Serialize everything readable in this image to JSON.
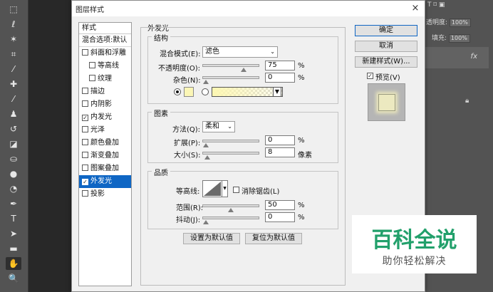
{
  "toolbar": {
    "tools": [
      {
        "icon": "marquee-icon",
        "glyph": "⬚"
      },
      {
        "icon": "lasso-icon",
        "glyph": "ℓ"
      },
      {
        "icon": "magic-wand-icon",
        "glyph": "✶"
      },
      {
        "icon": "crop-icon",
        "glyph": "⌗"
      },
      {
        "icon": "eyedropper-icon",
        "glyph": "⁄"
      },
      {
        "icon": "healing-brush-icon",
        "glyph": "✚"
      },
      {
        "icon": "brush-icon",
        "glyph": "⁄"
      },
      {
        "icon": "stamp-icon",
        "glyph": "♟"
      },
      {
        "icon": "history-brush-icon",
        "glyph": "↺"
      },
      {
        "icon": "eraser-icon",
        "glyph": "◪"
      },
      {
        "icon": "bucket-icon",
        "glyph": "⛀"
      },
      {
        "icon": "blur-icon",
        "glyph": "●"
      },
      {
        "icon": "dodge-icon",
        "glyph": "◔"
      },
      {
        "icon": "pen-icon",
        "glyph": "✒"
      },
      {
        "icon": "type-icon",
        "glyph": "T"
      },
      {
        "icon": "path-select-icon",
        "glyph": "➤"
      },
      {
        "icon": "rectangle-icon",
        "glyph": "▬"
      },
      {
        "icon": "hand-icon",
        "glyph": "✋"
      },
      {
        "icon": "zoom-icon",
        "glyph": "🔍"
      }
    ]
  },
  "right_panel": {
    "opacity_label": "透明度:",
    "opacity_value": "100%",
    "fill_label": "填充:",
    "fill_value": "100%",
    "fx": "fx"
  },
  "dialog": {
    "title": "图层样式",
    "close": "×",
    "styles_header": "样式",
    "blend_options": "混合选项:默认",
    "styles": [
      {
        "label": "斜面和浮雕",
        "checked": false,
        "indent": false,
        "selected": false
      },
      {
        "label": "等高线",
        "checked": false,
        "indent": true,
        "selected": false
      },
      {
        "label": "纹理",
        "checked": false,
        "indent": true,
        "selected": false
      },
      {
        "label": "描边",
        "checked": false,
        "indent": false,
        "selected": false
      },
      {
        "label": "内阴影",
        "checked": false,
        "indent": false,
        "selected": false
      },
      {
        "label": "内发光",
        "checked": true,
        "indent": false,
        "selected": false
      },
      {
        "label": "光泽",
        "checked": false,
        "indent": false,
        "selected": false
      },
      {
        "label": "颜色叠加",
        "checked": false,
        "indent": false,
        "selected": false
      },
      {
        "label": "渐变叠加",
        "checked": false,
        "indent": false,
        "selected": false
      },
      {
        "label": "图案叠加",
        "checked": false,
        "indent": false,
        "selected": false
      },
      {
        "label": "外发光",
        "checked": true,
        "indent": false,
        "selected": true
      },
      {
        "label": "投影",
        "checked": false,
        "indent": false,
        "selected": false
      }
    ],
    "section_title": "外发光",
    "structure": {
      "label": "结构",
      "blend_mode_label": "混合模式(E):",
      "blend_mode_value": "滤色",
      "opacity_label": "不透明度(O):",
      "opacity_value": "75",
      "opacity_fraction": 0.75,
      "noise_label": "杂色(N):",
      "noise_value": "0",
      "noise_fraction": 0,
      "percent": "%",
      "glow_color": "#fbf6b6"
    },
    "elements": {
      "label": "图素",
      "technique_label": "方法(Q):",
      "technique_value": "柔和",
      "spread_label": "扩展(P):",
      "spread_value": "0",
      "spread_fraction": 0,
      "size_label": "大小(S):",
      "size_value": "8",
      "size_fraction": 0.032,
      "percent": "%",
      "px_unit": "像素"
    },
    "quality": {
      "label": "品质",
      "contour_label": "等高线:",
      "anti_alias_label": "消除锯齿(L)",
      "range_label": "范围(R):",
      "range_value": "50",
      "range_fraction": 0.5,
      "jitter_label": "抖动(J):",
      "jitter_value": "0",
      "jitter_fraction": 0,
      "percent": "%"
    },
    "make_default": "设置为默认值",
    "reset_default": "复位为默认值",
    "ok": "确定",
    "cancel": "取消",
    "new_style": "新建样式(W)...",
    "preview_label": "预览(V)",
    "preview_checked": true
  },
  "watermark": {
    "title": "百科全说",
    "subtitle": "助你轻松解决"
  }
}
